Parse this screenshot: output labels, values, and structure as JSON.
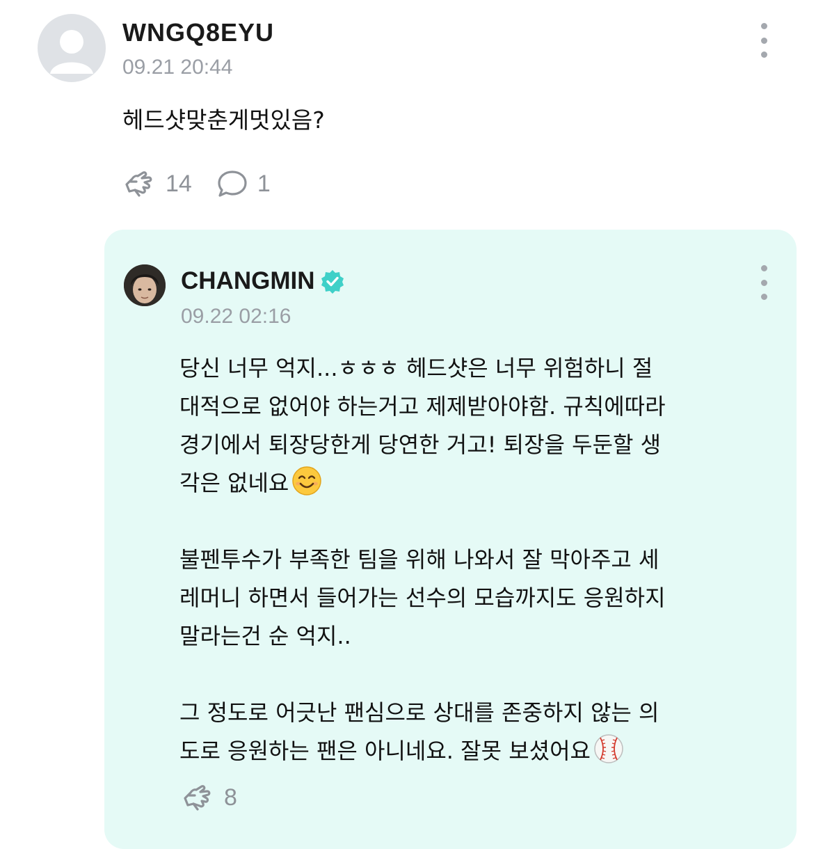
{
  "comment": {
    "username": "WNGQ8EYU",
    "timestamp": "09.21 20:44",
    "text": "헤드샷맞춘게멋있음?",
    "likes": "14",
    "replies": "1",
    "icons": [
      "default-avatar-icon",
      "more-vertical-icon",
      "like-hand-icon",
      "reply-bubble-icon"
    ]
  },
  "reply": {
    "username": "CHANGMIN",
    "timestamp": "09.22 02:16",
    "paragraphs": [
      " 당신 너무 억지...ㅎㅎㅎ 헤드샷은 너무 위험하니 절\n대적으로 없어야 하는거고 제제받아야함. 규칙에따라\n경기에서 퇴장당한게 당연한 거고! 퇴장을 두둔할 생\n각은 없네요",
      " 불펜투수가 부족한 팀을 위해 나와서 잘 막아주고 세\n레머니 하면서 들어가는 선수의 모습까지도 응원하지\n말라는건 순 억지..",
      " 그 정도로 어긋난 팬심으로 상대를 존중하지 않는 의\n도로 응원하는 팬은 아니네요. 잘못 보셨어요"
    ],
    "likes": "8",
    "icons": [
      "avatar-photo",
      "verified-badge-icon",
      "smile-emoji-icon",
      "baseball-emoji-icon",
      "like-hand-icon",
      "more-vertical-icon"
    ],
    "card_color": "#e5faf6",
    "verified_color": "#3fd0c8"
  }
}
